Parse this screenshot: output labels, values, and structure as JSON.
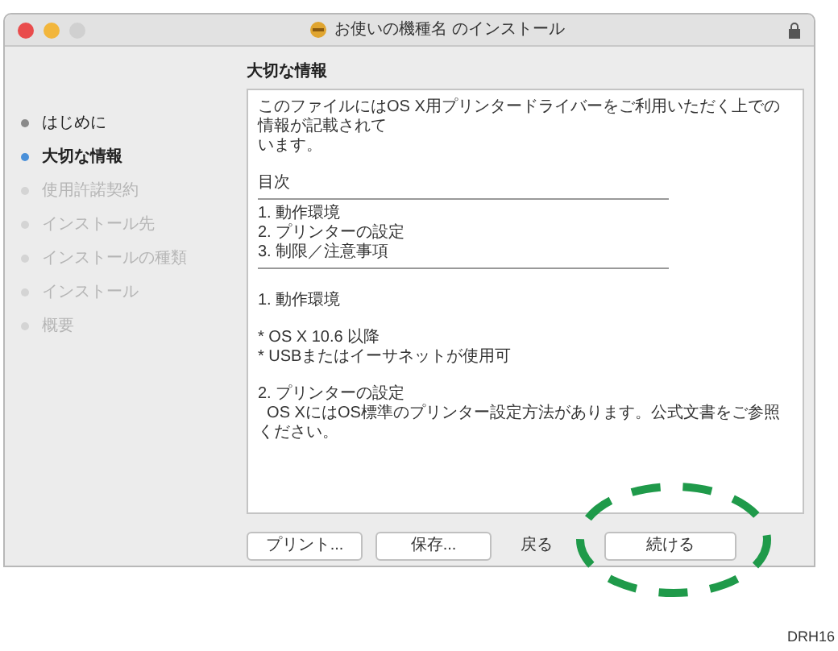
{
  "window": {
    "title": "お使いの機種名 のインストール"
  },
  "sidebar": {
    "items": [
      {
        "label": "はじめに",
        "selected": false,
        "disabled": false
      },
      {
        "label": "大切な情報",
        "selected": true,
        "disabled": false
      },
      {
        "label": "使用許諾契約",
        "selected": false,
        "disabled": true
      },
      {
        "label": "インストール先",
        "selected": false,
        "disabled": true
      },
      {
        "label": "インストールの種類",
        "selected": false,
        "disabled": true
      },
      {
        "label": "インストール",
        "selected": false,
        "disabled": true
      },
      {
        "label": "概要",
        "selected": false,
        "disabled": true
      }
    ]
  },
  "content": {
    "heading": "大切な情報",
    "blocks": [
      {
        "kind": "text",
        "lines": [
          "このファイルにはOS X用プリンタードライバーをご利用いただく上での",
          "情報が記載されて",
          "います。"
        ]
      },
      {
        "kind": "gap"
      },
      {
        "kind": "text",
        "lines": [
          "目次"
        ]
      },
      {
        "kind": "rule"
      },
      {
        "kind": "text",
        "lines": [
          "1. 動作環境",
          "2. プリンターの設定",
          "3. 制限／注意事項"
        ]
      },
      {
        "kind": "rule"
      },
      {
        "kind": "gap"
      },
      {
        "kind": "text",
        "lines": [
          "1. 動作環境"
        ]
      },
      {
        "kind": "gap"
      },
      {
        "kind": "text",
        "lines": [
          "* OS X 10.6 以降",
          "* USBまたはイーサネットが使用可"
        ]
      },
      {
        "kind": "gap"
      },
      {
        "kind": "text",
        "lines": [
          "2. プリンターの設定",
          "  OS XにはOS標準のプリンター設定方法があります。公式文書をご参照",
          "ください。"
        ]
      }
    ]
  },
  "buttons": [
    {
      "label": "プリント...",
      "kind": "left"
    },
    {
      "label": "保存...",
      "kind": "left"
    },
    {
      "label": "戻る",
      "kind": "plain"
    },
    {
      "label": "続ける",
      "kind": "default",
      "highlighted": true
    }
  ],
  "figure_code": "DRH16"
}
